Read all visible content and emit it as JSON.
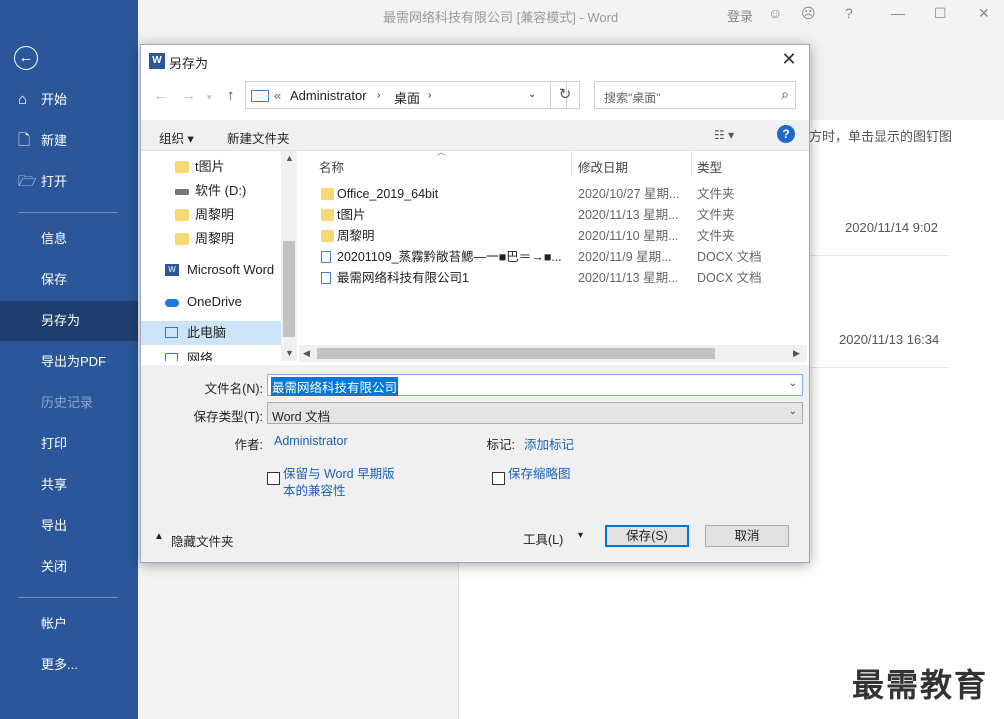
{
  "window": {
    "title": "最需网络科技有限公司 [兼容模式]  -  Word",
    "login": "登录",
    "buttons": {
      "smile": "☺",
      "frown": "☹",
      "help": "?",
      "minimize": "—",
      "maximize": "☐",
      "close": "✕"
    }
  },
  "backstage": {
    "items": [
      {
        "label": "开始",
        "icon": "home-icon"
      },
      {
        "label": "新建",
        "icon": "new-doc-icon"
      },
      {
        "label": "打开",
        "icon": "open-folder-icon"
      },
      {
        "label": "信息"
      },
      {
        "label": "保存"
      },
      {
        "label": "另存为",
        "selected": true
      },
      {
        "label": "导出为PDF"
      },
      {
        "label": "历史记录",
        "disabled": true
      },
      {
        "label": "打印"
      },
      {
        "label": "共享"
      },
      {
        "label": "导出"
      },
      {
        "label": "关闭"
      },
      {
        "label": "帐户"
      },
      {
        "label": "更多..."
      }
    ]
  },
  "background": {
    "hint_text": "方时，单击显示的图钉图",
    "time1": "2020/11/14 9:02",
    "time2": "2020/11/13 16:34",
    "watermark": "最需教育"
  },
  "dialog": {
    "title": "另存为",
    "close": "✕",
    "address": {
      "prefix": "«",
      "segments": [
        "Administrator",
        "桌面"
      ]
    },
    "search_placeholder": "搜索\"桌面\"",
    "toolbar": {
      "organize": "组织 ▾",
      "new_folder": "新建文件夹"
    },
    "tree": [
      {
        "label": "t图片",
        "kind": "folder"
      },
      {
        "label": "软件 (D:)",
        "kind": "drive"
      },
      {
        "label": "周黎明",
        "kind": "folder"
      },
      {
        "label": "周黎明",
        "kind": "folder"
      },
      {
        "label": "Microsoft Word",
        "kind": "word"
      },
      {
        "label": "OneDrive",
        "kind": "cloud"
      },
      {
        "label": "此电脑",
        "kind": "pc",
        "selected": true
      },
      {
        "label": "网络",
        "kind": "network"
      }
    ],
    "columns": {
      "name": "名称",
      "date": "修改日期",
      "type": "类型"
    },
    "files": [
      {
        "name": "Office_2019_64bit",
        "date": "2020/10/27 星期...",
        "type": "文件夹",
        "kind": "folder"
      },
      {
        "name": "t图片",
        "date": "2020/11/13 星期...",
        "type": "文件夹",
        "kind": "folder"
      },
      {
        "name": "周黎明",
        "date": "2020/11/10 星期...",
        "type": "文件夹",
        "kind": "folder"
      },
      {
        "name": "20201109_蒸霧黔敞苔鰓—一■巴＝→■...",
        "date": "2020/11/9 星期...",
        "type": "DOCX 文档",
        "kind": "doc"
      },
      {
        "name": "最需网络科技有限公司1",
        "date": "2020/11/13 星期...",
        "type": "DOCX 文档",
        "kind": "doc"
      }
    ],
    "form": {
      "filename_label": "文件名(N):",
      "filename_value": "最需网络科技有限公司",
      "type_label": "保存类型(T):",
      "type_value": "Word 文档",
      "author_label": "作者:",
      "author_value": "Administrator",
      "tags_label": "标记:",
      "tags_value": "添加标记",
      "compat_line1": "保留与 Word 早期版",
      "compat_line2": "本的兼容性",
      "thumbnail": "保存缩略图",
      "hide_folders": "隐藏文件夹",
      "tools": "工具(L)",
      "save": "保存(S)",
      "cancel": "取消"
    }
  }
}
